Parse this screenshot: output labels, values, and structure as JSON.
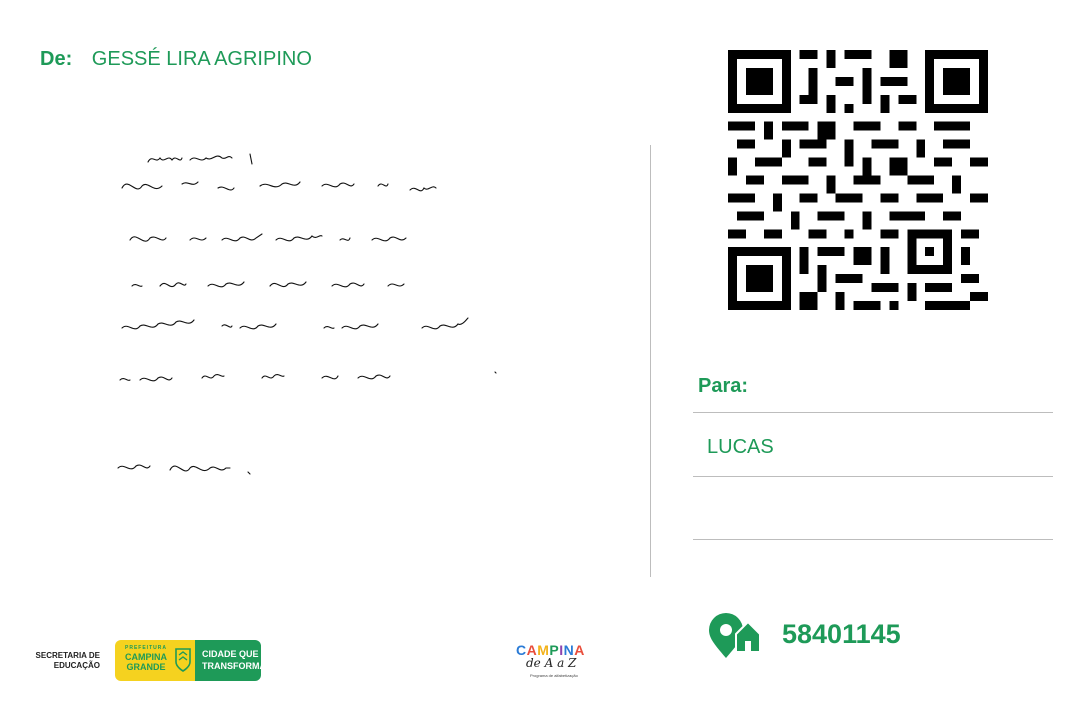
{
  "sender": {
    "label": "De:",
    "name": "GESSÉ LIRA AGRIPINO"
  },
  "letter": {
    "lines": [
      "Amigo, Heitorneli!",
      "Quando vier a campina grande, vá ao",
      "Parque do povo, conhecer a pirâmide",
      "o local nosso central para as",
      "apresentação musicais e culturas durante",
      "o maior São João do mundo",
      "Pedro Henrique."
    ]
  },
  "recipient": {
    "label": "Para:",
    "name": "LUCAS"
  },
  "cep": {
    "value": "58401145",
    "icon": "home-location-icon"
  },
  "footer": {
    "secretaria_line1": "SECRETARIA DE",
    "secretaria_line2": "EDUCAÇÃO",
    "prefeitura": "PREFEITURA",
    "city_line1": "CAMPINA",
    "city_line2": "GRANDE",
    "slogan_line1": "CIDADE QUE",
    "slogan_line2": "TRANSFORMA",
    "campaign_word": "CAMPINA",
    "campaign_sub": "de A a Z",
    "campaign_tiny": "Programa de alfabetização"
  },
  "colors": {
    "brand_green": "#1e9a58",
    "brand_yellow": "#f5d21f",
    "divider": "#bdbdbd"
  }
}
